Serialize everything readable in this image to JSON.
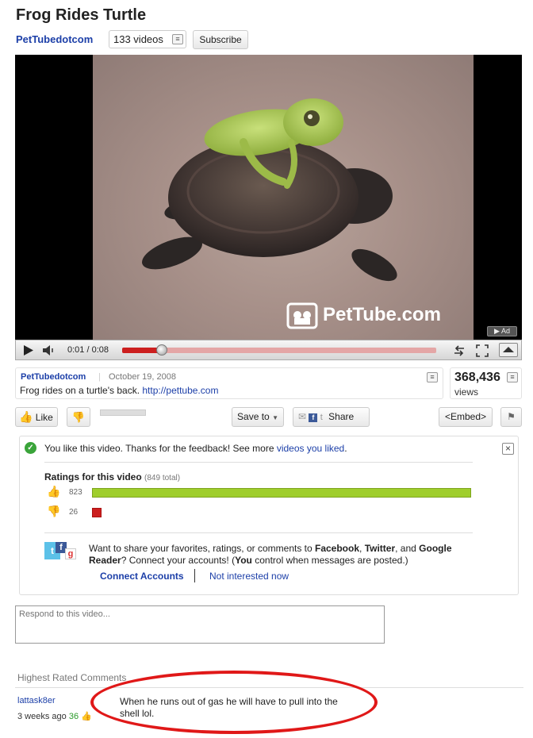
{
  "video": {
    "title": "Frog Rides Turtle",
    "channel": "PetTubedotcom",
    "video_count": "133 videos",
    "subscribe_label": "Subscribe",
    "watermark": "PetTube.com",
    "ad_label": "Ad"
  },
  "player": {
    "time": "0:01 / 0:08",
    "progress_fraction": 0.125
  },
  "info": {
    "uploader": "PetTubedotcom",
    "separator": "|",
    "date": "October 19, 2008",
    "description": "Frog rides on a turtle's back.",
    "link": "http://pettube.com",
    "views_count": "368,436",
    "views_label": "views"
  },
  "actions": {
    "like_label": "Like",
    "save_label": "Save to",
    "share_label": "Share",
    "embed_label": "<Embed>"
  },
  "feedback": {
    "message": "You like this video. Thanks for the feedback! See more ",
    "message_link": "videos you liked",
    "message_end": ".",
    "ratings_title": "Ratings for this video",
    "ratings_total": "(849 total)",
    "likes": "823",
    "dislikes": "26",
    "likes_value": 823,
    "dislikes_value": 26,
    "share_intro": "Want to share your favorites, ratings, or comments to ",
    "facebook": "Facebook",
    "comma": ", ",
    "twitter": "Twitter",
    "and": ", and ",
    "google": "Google Reader",
    "share_mid": "? Connect your accounts! (",
    "you": "You",
    "share_end": " control when messages are posted.)",
    "connect_label": "Connect Accounts",
    "not_interested_label": "Not interested now"
  },
  "comments": {
    "placeholder": "Respond to this video...",
    "section_title": "Highest Rated Comments",
    "items": [
      {
        "user": "lattask8er",
        "age": "3 weeks ago",
        "score": "36",
        "text": "When he runs out of gas he will have to pull into the shell lol."
      }
    ]
  },
  "colors": {
    "link": "#1c3fa8",
    "like_bar": "#9fce2c",
    "dislike_bar": "#cc1f1f",
    "annotation": "#e01818"
  }
}
